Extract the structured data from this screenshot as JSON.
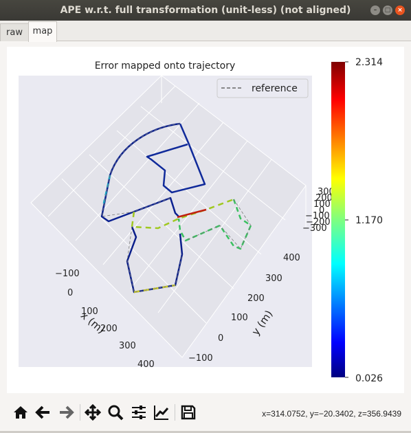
{
  "window": {
    "title": "APE w.r.t. full transformation (unit-less) (not aligned)"
  },
  "tabs": [
    {
      "label": "raw",
      "active": false
    },
    {
      "label": "map",
      "active": true
    }
  ],
  "plot": {
    "title": "Error mapped onto trajectory",
    "legend": "reference",
    "x_axis": {
      "label": "x (m)",
      "ticks": [
        "−100",
        "0",
        "100",
        "200",
        "300",
        "400"
      ]
    },
    "y_axis": {
      "label": "y (m)",
      "ticks": [
        "−100",
        "0",
        "100",
        "200",
        "300",
        "400"
      ]
    },
    "z_axis": {
      "ticks": [
        "300",
        "200",
        "100",
        "0",
        "−100",
        "−200",
        "−300"
      ]
    },
    "colorbar": {
      "max": "2.314",
      "mid": "1.170",
      "min": "0.026",
      "colormap": "jet"
    }
  },
  "toolbar": {
    "icons": [
      "home-icon",
      "back-icon",
      "forward-icon",
      "pan-icon",
      "zoom-icon",
      "configure-subplots-icon",
      "edit-axis-icon",
      "save-icon"
    ],
    "coords": "x=314.0752, y=−20.3402, z=356.9439"
  }
}
